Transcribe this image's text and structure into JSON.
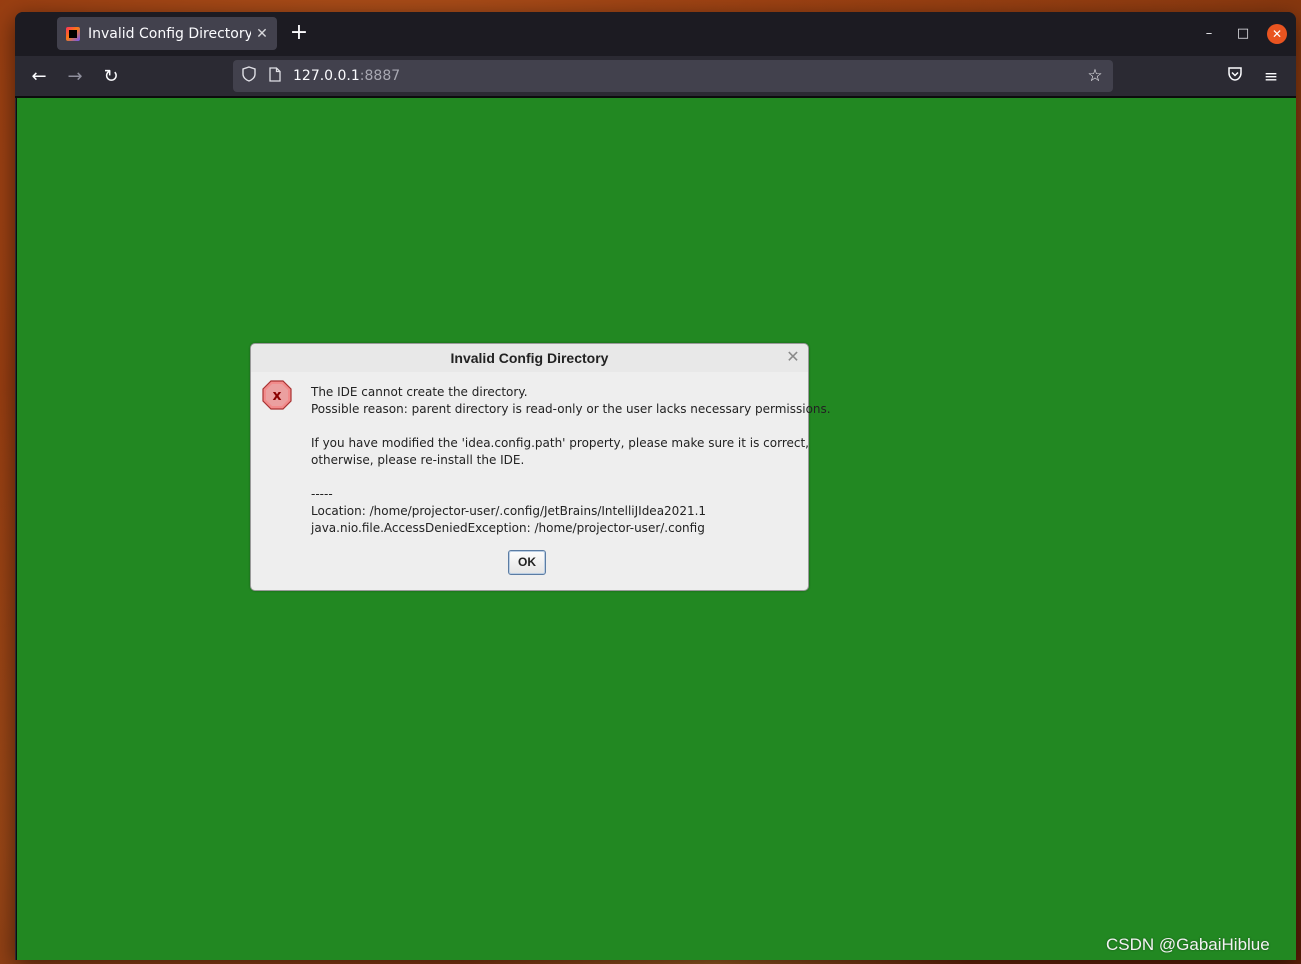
{
  "browser": {
    "tab": {
      "title": "Invalid Config Directory",
      "close_glyph": "✕",
      "favicon": "intellij-icon"
    },
    "new_tab_glyph": "+",
    "window_controls": {
      "minimize_glyph": "–",
      "maximize_glyph": "□",
      "close_glyph": "✕"
    },
    "nav": {
      "back_glyph": "←",
      "forward_glyph": "→",
      "reload_glyph": "↻"
    },
    "url": {
      "host": "127.0.0.1",
      "port": ":8887"
    },
    "bookmark_glyph": "☆",
    "pocket_glyph": "♡",
    "menu_glyph": "≡"
  },
  "dialog": {
    "title": "Invalid Config Directory",
    "close_glyph": "✕",
    "icon": "error-icon",
    "lines": [
      "The IDE cannot create the directory.",
      "Possible reason: parent directory is read-only or the user lacks necessary permissions.",
      "",
      "If you have modified the 'idea.config.path' property, please make sure it is correct,",
      "otherwise, please re-install the IDE.",
      "",
      "-----",
      "Location: /home/projector-user/.config/JetBrains/IntelliJIdea2021.1",
      "java.nio.file.AccessDeniedException: /home/projector-user/.config"
    ],
    "ok_label": "OK"
  },
  "colors": {
    "page_background": "#228822",
    "dialog_background": "#eeeeee",
    "error_icon": "#e34f4f",
    "os_close": "#e95420"
  },
  "watermark": "CSDN @GabaiHiblue"
}
